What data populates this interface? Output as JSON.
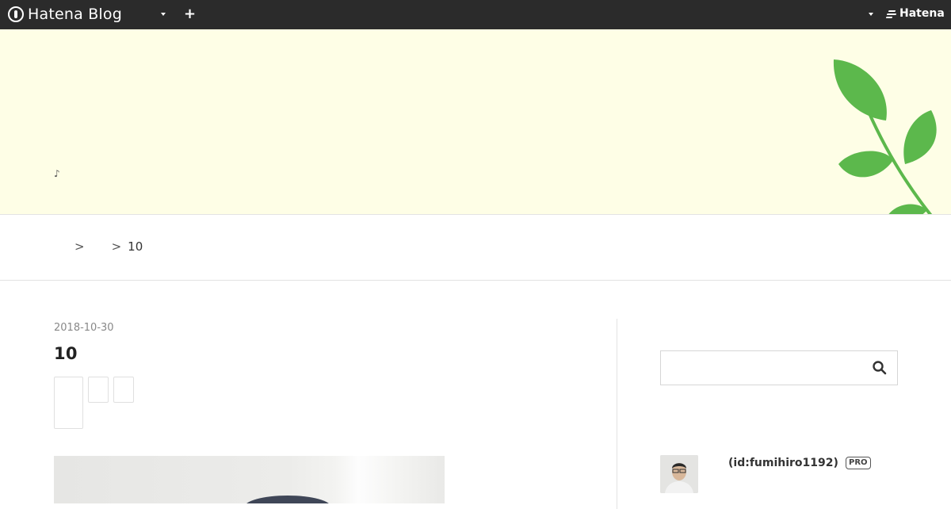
{
  "global_header": {
    "logo_text": "Hatena Blog",
    "add_label": "+",
    "brand_text": "Hatena"
  },
  "blog": {
    "title": "",
    "description": "♪"
  },
  "breadcrumb": {
    "items": [
      "",
      "",
      "10"
    ],
    "separator": ">"
  },
  "entry": {
    "date": "2018-10-30",
    "title": "10"
  },
  "sidebar": {
    "search_placeholder": "",
    "profile_id": "(id:fumihiro1192)",
    "pro_badge": "PRO"
  },
  "colors": {
    "global_bar": "#2b2b2b",
    "header_bg": "#fefee6",
    "leaf_green": "#5cb84c"
  }
}
